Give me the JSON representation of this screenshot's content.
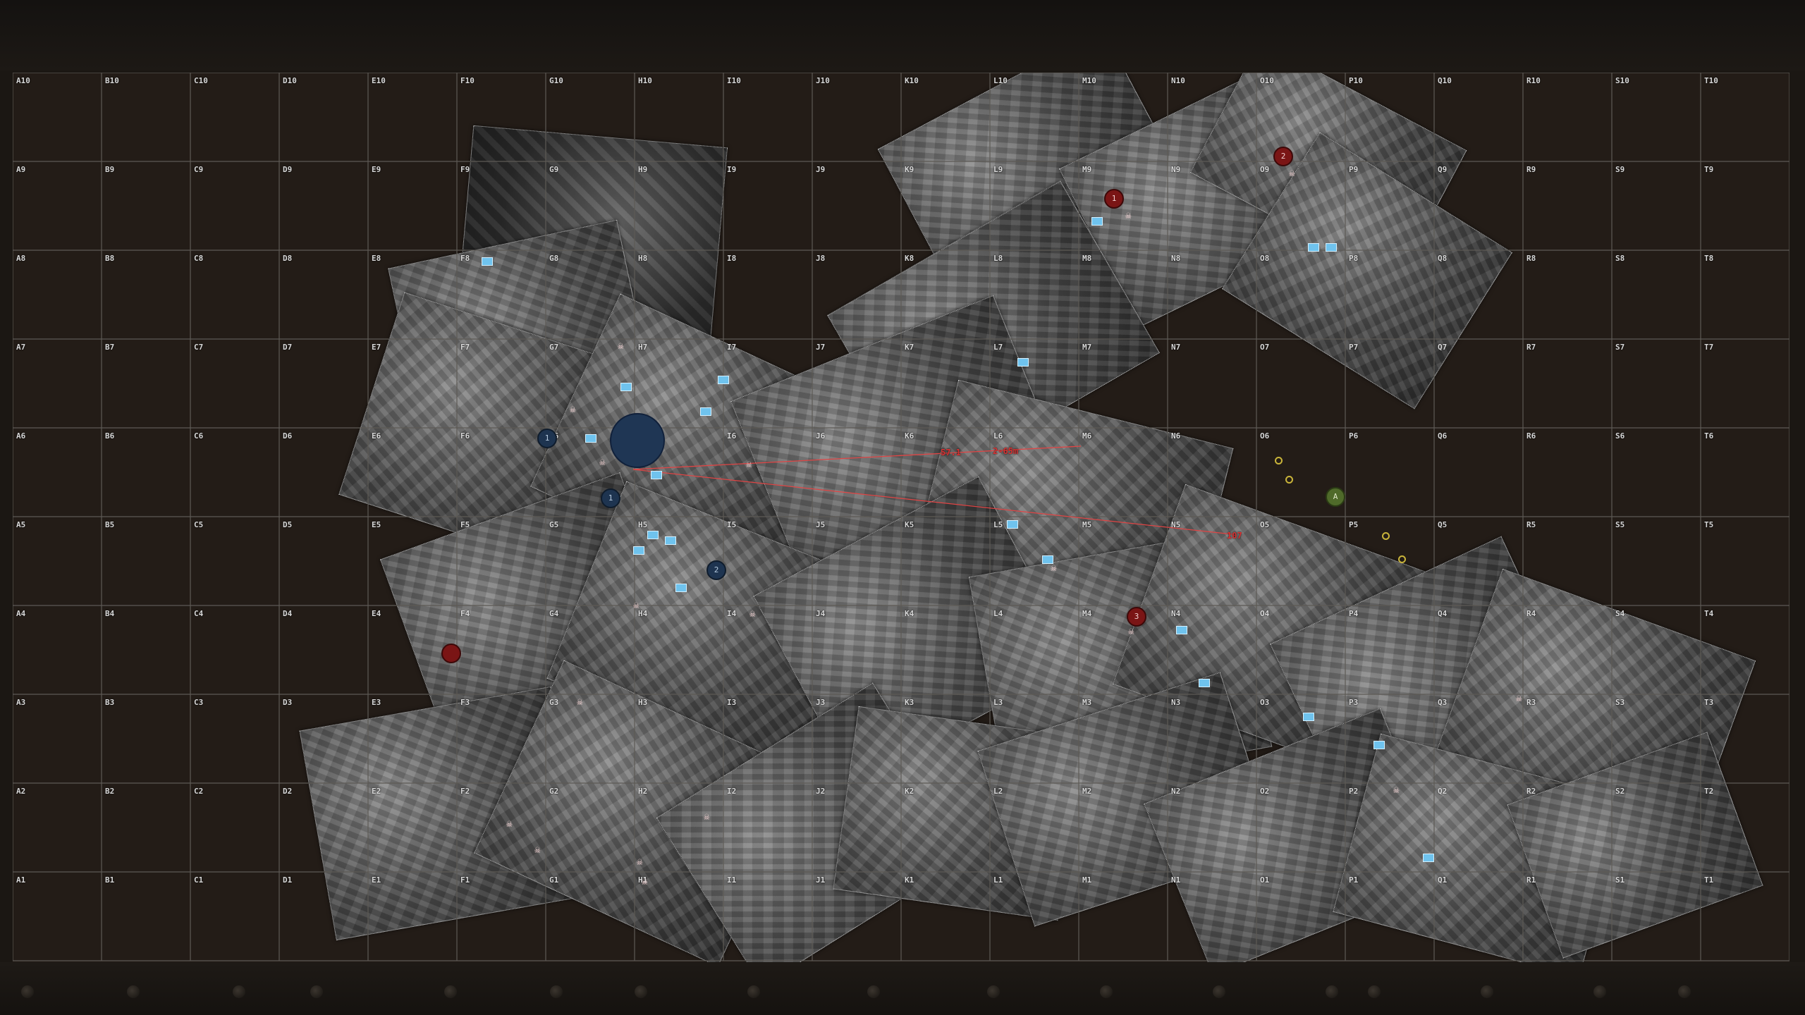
{
  "grid": {
    "columns": [
      "A",
      "B",
      "C",
      "D",
      "E",
      "F",
      "G",
      "H",
      "I",
      "J",
      "K",
      "L",
      "M",
      "N",
      "O",
      "P",
      "Q",
      "R",
      "S",
      "T"
    ],
    "rows": [
      10,
      9,
      8,
      7,
      6,
      5,
      4,
      3,
      2,
      1
    ],
    "line_color": "#5d5a55",
    "label_color": "#d8d8d8"
  },
  "measurements": {
    "labels": [
      "57.1",
      "2-65m",
      "107"
    ],
    "line_color": "#e04545"
  },
  "markers": {
    "enemy_color": "#7a1515",
    "friendly_color": "#1e3450",
    "objective_color": "#1f3654",
    "pins": [
      {
        "kind": "enemy",
        "label": "1"
      },
      {
        "kind": "enemy",
        "label": "2"
      },
      {
        "kind": "enemy",
        "label": "3"
      },
      {
        "kind": "enemy",
        "label": ""
      },
      {
        "kind": "friendly",
        "label": "1"
      },
      {
        "kind": "friendly",
        "label": "1"
      },
      {
        "kind": "friendly",
        "label": "2"
      },
      {
        "kind": "green",
        "label": "A"
      }
    ],
    "icons": [
      "skull-icon",
      "flag-icon",
      "waypoint-icon"
    ]
  }
}
